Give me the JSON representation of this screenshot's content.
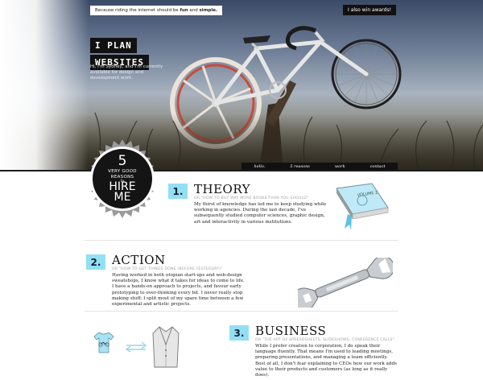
{
  "hero": {
    "tagline_prefix": "Because riding the internet should be ",
    "tagline_fun": "fun",
    "tagline_and": " and ",
    "tagline_simple": "simple.",
    "awards_label": "I also win awards!",
    "plan_line1": "I PLAN",
    "plan_line2": "WEBSITES",
    "plan_desc": "Hi, I'm Sydney, and I'm currently available for design and development work."
  },
  "nav": {
    "items": [
      "hello.",
      "5 reasons",
      "work",
      "contact"
    ]
  },
  "badge": {
    "number": "5",
    "line1": "VERY GOOD",
    "line2": "REASONS",
    "to": "to",
    "hire": "HIRE",
    "me": "ME"
  },
  "sections": [
    {
      "number": "1.",
      "title": "THEORY",
      "subtitle": "OR \"HOW TO BUY WAY MORE BOOKS THAN YOU SHOULD\"",
      "body": "My thirst of knowledge has led me to keep studying while working in agencies. During the last decade, I've subsequently studied computer sciences, graphic design, art and interactivity in various institutions."
    },
    {
      "number": "2.",
      "title": "ACTION",
      "subtitle": "OR \"HOW TO GET THINGS DONE (BEFORE YESTERDAY)\"",
      "body": "Having worked in both utopian start-ups and web-design sweatshops, I know what it takes for ideas to come to life. I have a hands-on approach to projects, and favour early prototyping to over-thinking every bit. I never really stop making stuff; I split most of my spare time between a few experimental and artistic projects."
    },
    {
      "number": "3.",
      "title": "BUSINESS",
      "subtitle": "OR \"THE ART OF SPREADSHEETS, SLIDESHOWS, CONFERENCE CALLS\"",
      "body": "While I prefer creation to corporation, I do speak their language fluently. That means I'm used to leading meetings, preparing presentations, and managing a team efficiently. Best of all, I don't fear explaining to CEOs how our work adds value to their products and customers (as long as it really does)."
    }
  ],
  "icons": {
    "book": "book-icon",
    "wrench": "wrench-icon",
    "tshirt": "tshirt-icon",
    "blazer": "blazer-icon",
    "arrows": "swap-arrows-icon",
    "bicycle": "bicycle-illustration"
  },
  "book_label": "VOLUME 2",
  "colors": {
    "accent": "#93dff4",
    "dark": "#111111"
  }
}
